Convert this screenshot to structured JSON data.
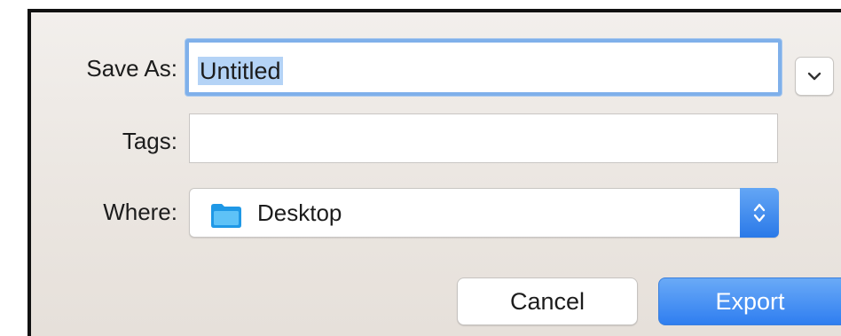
{
  "dialog": {
    "save_as_label": "Save As:",
    "filename_value": "Untitled",
    "tags_label": "Tags:",
    "tags_value": "",
    "where_label": "Where:",
    "where_value": "Desktop",
    "cancel_label": "Cancel",
    "export_label": "Export"
  },
  "icons": {
    "expand": "chevron-down-icon",
    "location": "folder-icon",
    "location_stepper": "up-down-chevron-icon"
  },
  "colors": {
    "accent": "#2f7ef0",
    "focus_ring": "#7fb0ea",
    "selection": "#b4d3f6",
    "folder": "#2aa7ef"
  }
}
